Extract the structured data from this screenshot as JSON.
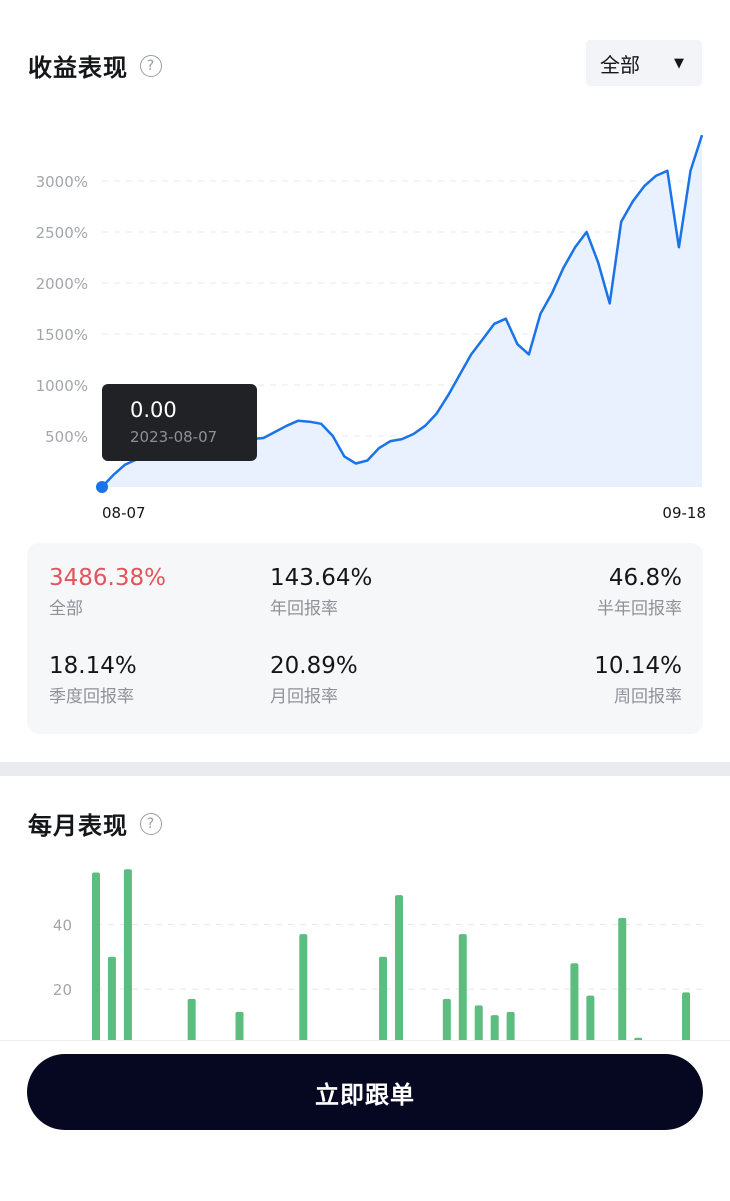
{
  "performance": {
    "title": "收益表现",
    "help_icon": "question-circle-icon",
    "range_selected": "全部",
    "caret_icon": "caret-down-icon",
    "tooltip": {
      "value": "0.00",
      "date": "2023-08-07"
    },
    "stats": [
      {
        "value": "3486.38%",
        "label": "全部",
        "highlight": true
      },
      {
        "value": "143.64%",
        "label": "年回报率"
      },
      {
        "value": "46.8%",
        "label": "半年回报率"
      },
      {
        "value": "18.14%",
        "label": "季度回报率"
      },
      {
        "value": "20.89%",
        "label": "月回报率"
      },
      {
        "value": "10.14%",
        "label": "周回报率"
      }
    ]
  },
  "monthly": {
    "title": "每月表现",
    "help_icon": "question-circle-icon"
  },
  "cta": {
    "label": "立即跟单"
  },
  "colors": {
    "line": "#1a73e8",
    "area": "#e8f1fd",
    "bar": "#5bbd7f",
    "highlight": "#e2545a",
    "cta_bg": "#060720"
  },
  "chart_data": [
    {
      "type": "area",
      "x_labels": [
        "08-07",
        "09-18"
      ],
      "y_ticks": [
        "500%",
        "1000%",
        "1500%",
        "2000%",
        "2500%",
        "3000%"
      ],
      "ylim": [
        0,
        3500
      ],
      "grid": true,
      "series": [
        {
          "values": [
            0,
            120,
            220,
            270,
            290,
            300,
            340,
            380,
            400,
            430,
            440,
            450,
            460,
            470,
            480,
            540,
            600,
            650,
            640,
            620,
            500,
            300,
            230,
            260,
            380,
            450,
            470,
            520,
            600,
            720,
            900,
            1100,
            1300,
            1450,
            1600,
            1650,
            1400,
            1300,
            1700,
            1900,
            2150,
            2350,
            2500,
            2200,
            1800,
            2600,
            2800,
            2950,
            3050,
            3100,
            2350,
            3100,
            3450
          ]
        }
      ]
    },
    {
      "type": "bar",
      "y_ticks": [
        "20",
        "40"
      ],
      "ylim": [
        0,
        58
      ],
      "grid": true,
      "series": [
        {
          "values": [
            56,
            30,
            57,
            0,
            0,
            0,
            17,
            0,
            0,
            13,
            0,
            0,
            0,
            37,
            0,
            0,
            0,
            0,
            30,
            49,
            0,
            0,
            17,
            37,
            15,
            12,
            13,
            0,
            0,
            0,
            28,
            18,
            0,
            42,
            5,
            0,
            0,
            19
          ]
        }
      ]
    }
  ]
}
